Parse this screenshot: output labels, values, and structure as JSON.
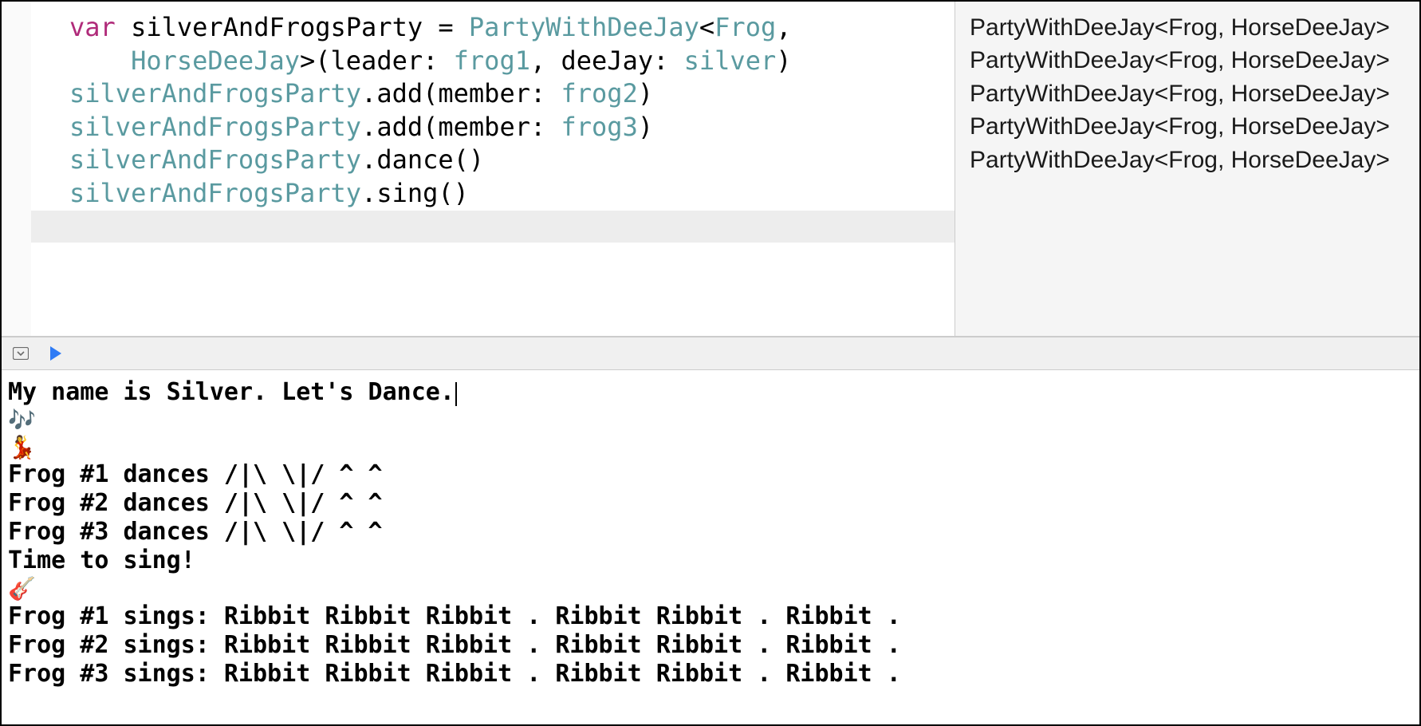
{
  "code": {
    "line1": {
      "kw": "var",
      "space1": " ",
      "name": "silverAndFrogsParty",
      "eq": " = ",
      "type1": "PartyWithDeeJay",
      "lt": "<",
      "type2": "Frog",
      "comma": ","
    },
    "line2": {
      "indent": "    ",
      "type3": "HorseDeeJay",
      "gt": ">(leader: ",
      "arg1": "frog1",
      "mid": ", deeJay: ",
      "arg2": "silver",
      "close": ")"
    },
    "line3": "",
    "line4": {
      "obj": "silverAndFrogsParty",
      "call": ".add(member: ",
      "arg": "frog2",
      "close": ")"
    },
    "line5": {
      "obj": "silverAndFrogsParty",
      "call": ".add(member: ",
      "arg": "frog3",
      "close": ")"
    },
    "line6": "",
    "line7": {
      "obj": "silverAndFrogsParty",
      "call": ".dance()"
    },
    "line8": {
      "obj": "silverAndFrogsParty",
      "call": ".sing()"
    }
  },
  "results": {
    "r1": "PartyWithDeeJay<Frog, HorseDeeJay>",
    "r2": "",
    "r3": "",
    "r4": "PartyWithDeeJay<Frog, HorseDeeJay>",
    "r5": "PartyWithDeeJay<Frog, HorseDeeJay>",
    "r6": "",
    "r7": "PartyWithDeeJay<Frog, HorseDeeJay>",
    "r8": "PartyWithDeeJay<Frog, HorseDeeJay>"
  },
  "console": {
    "l1": "My name is Silver. Let's Dance.",
    "l2": "🎶",
    "l3": "💃",
    "l4": "Frog #1 dances /|\\ \\|/ ^ ^",
    "l5": "Frog #2 dances /|\\ \\|/ ^ ^",
    "l6": "Frog #3 dances /|\\ \\|/ ^ ^",
    "l7": "Time to sing!",
    "l8": "🎸",
    "l9": "Frog #1 sings: Ribbit Ribbit Ribbit . Ribbit Ribbit . Ribbit .",
    "l10": "Frog #2 sings: Ribbit Ribbit Ribbit . Ribbit Ribbit . Ribbit .",
    "l11": "Frog #3 sings: Ribbit Ribbit Ribbit . Ribbit Ribbit . Ribbit ."
  }
}
